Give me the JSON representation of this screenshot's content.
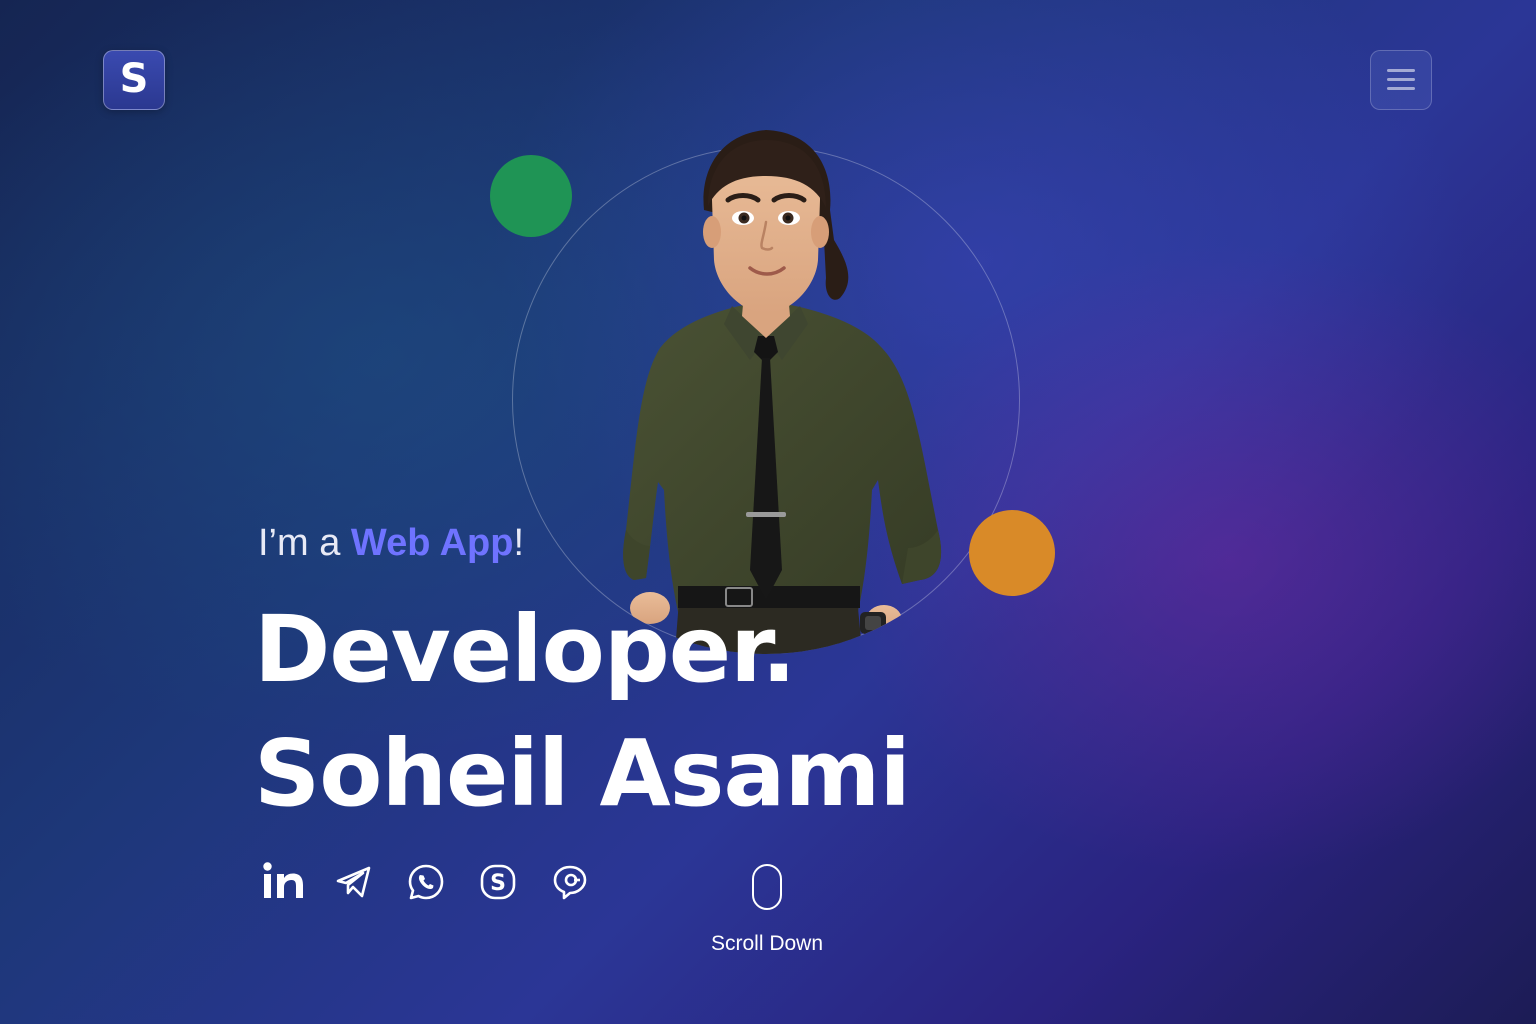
{
  "header": {
    "logo_letter": "S",
    "menu_icon": "hamburger-menu-icon"
  },
  "hero": {
    "intro_prefix": "I’m a ",
    "intro_accent": "Web App",
    "intro_suffix": "!",
    "headline_line1": "Developer.",
    "headline_line2": "Soheil Asami"
  },
  "socials": [
    {
      "icon": "linkedin-icon"
    },
    {
      "icon": "telegram-icon"
    },
    {
      "icon": "whatsapp-icon"
    },
    {
      "icon": "skype-icon"
    },
    {
      "icon": "chat-icon"
    }
  ],
  "scroll": {
    "label": "Scroll Down"
  },
  "colors": {
    "accent": "#6f73ff",
    "green_dot": "#1f9455",
    "orange_dot": "#d98a28"
  }
}
